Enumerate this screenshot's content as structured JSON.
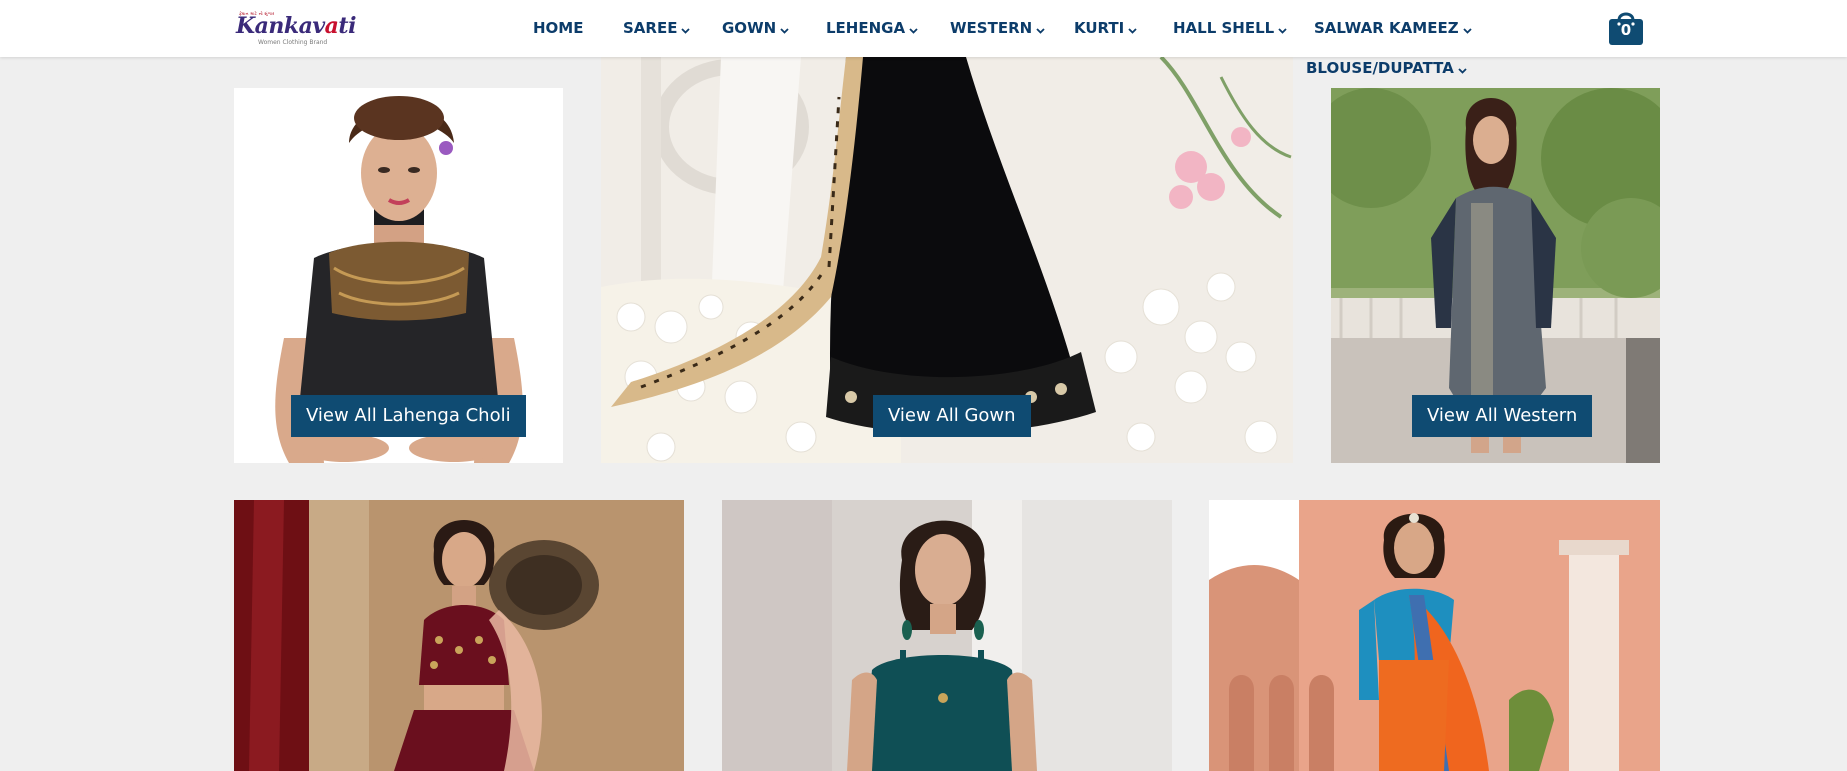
{
  "header": {
    "logo": {
      "tagline_top": "ફેશન માટે નો શૃંગાર",
      "name_part1": "Kankav",
      "name_accent": "a",
      "name_part2": "ti",
      "tagline": "Women Clothing Brand"
    },
    "nav": [
      {
        "label": "HOME",
        "has_dropdown": false
      },
      {
        "label": "SAREE",
        "has_dropdown": true
      },
      {
        "label": "GOWN",
        "has_dropdown": true
      },
      {
        "label": "LEHENGA",
        "has_dropdown": true
      },
      {
        "label": "WESTERN",
        "has_dropdown": true
      },
      {
        "label": "KURTI",
        "has_dropdown": true
      },
      {
        "label": "HALL SHELL",
        "has_dropdown": true
      },
      {
        "label": "SALWAR KAMEEZ",
        "has_dropdown": true
      },
      {
        "label": "BLOUSE/DUPATTA",
        "has_dropdown": true
      }
    ],
    "cart": {
      "count": "0",
      "icon": "shopping-bag-icon"
    }
  },
  "tiles": {
    "lahenga_choli": {
      "button_label": "View All Lahenga Choli",
      "image": "woman-in-black-choli-photo"
    },
    "gown": {
      "button_label": "View All Gown",
      "image": "black-gown-with-dupatta-photo"
    },
    "western": {
      "button_label": "View All Western",
      "image": "woman-in-grey-kurti-photo"
    },
    "lehenga": {
      "image": "woman-in-maroon-lehenga-photo"
    },
    "teal_outfit": {
      "image": "woman-in-teal-cold-shoulder-top-photo"
    },
    "saree": {
      "image": "woman-in-orange-saree-photo"
    }
  },
  "colors": {
    "nav_text": "#0c3c6a",
    "button_bg": "#0f4b72",
    "cart_bg": "#0f4b72",
    "page_bg": "#efefef"
  }
}
